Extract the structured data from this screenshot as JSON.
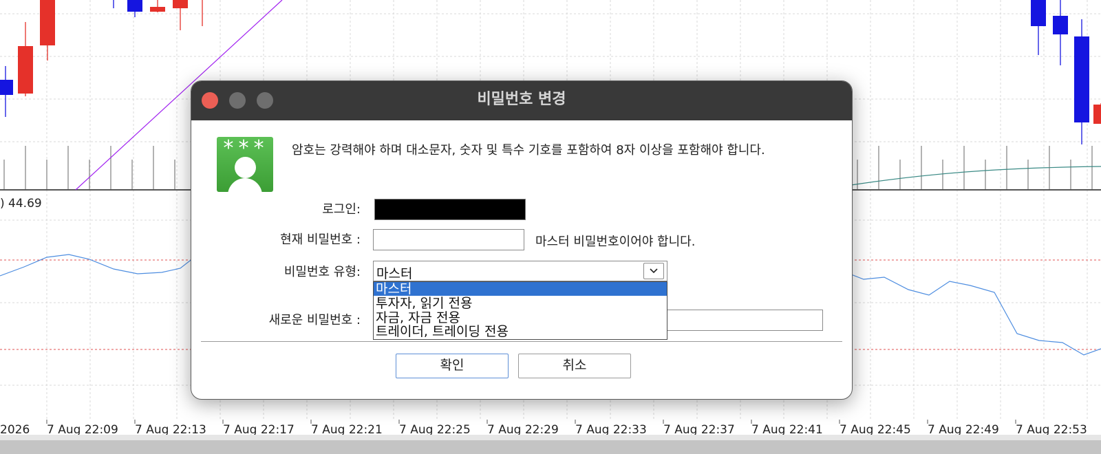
{
  "background_chart": {
    "indicator_value": ") 44.69",
    "time_labels": [
      "2026",
      "7 Aug 22:09",
      "7 Aug 22:13",
      "7 Aug 22:17",
      "7 Aug 22:21",
      "7 Aug 22:25",
      "7 Aug 22:29",
      "7 Aug 22:33",
      "7 Aug 22:37",
      "7 Aug 22:41",
      "7 Aug 22:45",
      "7 Aug 22:49",
      "7 Aug 22:53"
    ],
    "colors": {
      "bull": "#1515e0",
      "bear": "#e5312a",
      "ma_line": "#a020f0",
      "signal_line": "#3a8a85",
      "oscillator": "#4d8de0",
      "level_line": "#e05050",
      "grid": "#d8d8d8"
    }
  },
  "dialog": {
    "title": "비밀번호 변경",
    "window_controls": [
      "close",
      "minimize",
      "maximize"
    ],
    "icon": "user-password-icon",
    "stars": "***",
    "notice": "암호는 강력해야 하며 대소문자, 숫자 및 특수 기호를 포함하여 8자 이상을 포함해야 합니다.",
    "login_label": "로그인:",
    "current_password_label": "현재 비밀번호 :",
    "current_password_hint": "마스터 비밀번호이어야 합니다.",
    "password_type_label": "비밀번호 유형:",
    "password_type_value": "마스터",
    "password_type_options": [
      "마스터",
      "투자자, 읽기 전용",
      "자금, 자금 전용",
      "트레이더, 트레이딩 전용"
    ],
    "new_password_label": "새로운 비밀번호 :",
    "ok_button": "확인",
    "cancel_button": "취소",
    "accent_color": "#2f72d0"
  }
}
